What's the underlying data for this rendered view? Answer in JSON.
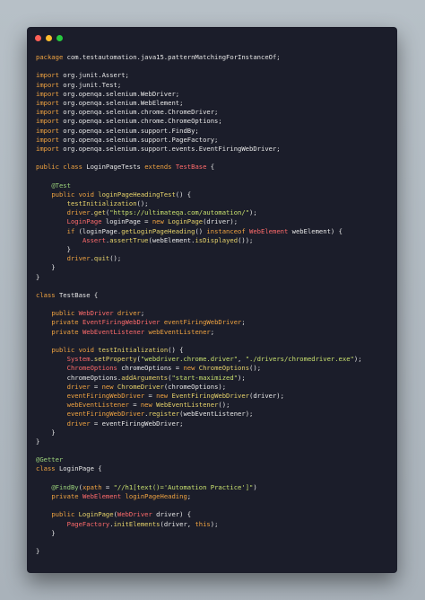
{
  "window": {
    "buttons": [
      {
        "name": "close",
        "color": "#ff5f56"
      },
      {
        "name": "minimize",
        "color": "#ffbd2e"
      },
      {
        "name": "zoom",
        "color": "#27c93f"
      }
    ]
  },
  "code": {
    "lines": [
      [
        [
          "kw",
          "package "
        ],
        [
          "pl",
          "com.testautomation.java15.patternMatchingForInstanceOf;"
        ]
      ],
      [],
      [
        [
          "kw",
          "import "
        ],
        [
          "pl",
          "org.junit.Assert;"
        ]
      ],
      [
        [
          "kw",
          "import "
        ],
        [
          "pl",
          "org.junit.Test;"
        ]
      ],
      [
        [
          "kw",
          "import "
        ],
        [
          "pl",
          "org.openqa.selenium.WebDriver;"
        ]
      ],
      [
        [
          "kw",
          "import "
        ],
        [
          "pl",
          "org.openqa.selenium.WebElement;"
        ]
      ],
      [
        [
          "kw",
          "import "
        ],
        [
          "pl",
          "org.openqa.selenium.chrome.ChromeDriver;"
        ]
      ],
      [
        [
          "kw",
          "import "
        ],
        [
          "pl",
          "org.openqa.selenium.chrome.ChromeOptions;"
        ]
      ],
      [
        [
          "kw",
          "import "
        ],
        [
          "pl",
          "org.openqa.selenium.support.FindBy;"
        ]
      ],
      [
        [
          "kw",
          "import "
        ],
        [
          "pl",
          "org.openqa.selenium.support.PageFactory;"
        ]
      ],
      [
        [
          "kw",
          "import "
        ],
        [
          "pl",
          "org.openqa.selenium.support.events.EventFiringWebDriver;"
        ]
      ],
      [],
      [
        [
          "kw",
          "public class "
        ],
        [
          "pl",
          "LoginPageTests "
        ],
        [
          "kw",
          "extends "
        ],
        [
          "tp",
          "TestBase"
        ],
        [
          "pl",
          " {"
        ]
      ],
      [],
      [
        [
          "pl",
          "    "
        ],
        [
          "an",
          "@Test"
        ]
      ],
      [
        [
          "pl",
          "    "
        ],
        [
          "kw",
          "public void "
        ],
        [
          "fn",
          "loginPageHeadingTest"
        ],
        [
          "pl",
          "() {"
        ]
      ],
      [
        [
          "pl",
          "        "
        ],
        [
          "fn",
          "testInitialization"
        ],
        [
          "pl",
          "();"
        ]
      ],
      [
        [
          "pl",
          "        "
        ],
        [
          "kw",
          "driver"
        ],
        [
          "pl",
          "."
        ],
        [
          "fn",
          "get"
        ],
        [
          "pl",
          "("
        ],
        [
          "str",
          "\"https://ultimateqa.com/automation/\""
        ],
        [
          "pl",
          ");"
        ]
      ],
      [
        [
          "pl",
          "        "
        ],
        [
          "tp",
          "LoginPage "
        ],
        [
          "pl",
          "loginPage = "
        ],
        [
          "kw",
          "new "
        ],
        [
          "fn",
          "LoginPage"
        ],
        [
          "pl",
          "(driver);"
        ]
      ],
      [
        [
          "pl",
          "        "
        ],
        [
          "kw",
          "if "
        ],
        [
          "pl",
          "(loginPage."
        ],
        [
          "fn",
          "getLoginPageHeading"
        ],
        [
          "pl",
          "() "
        ],
        [
          "kw",
          "instanceof "
        ],
        [
          "tp",
          "WebElement "
        ],
        [
          "pl",
          "webElement) {"
        ]
      ],
      [
        [
          "pl",
          "            "
        ],
        [
          "tp",
          "Assert"
        ],
        [
          "pl",
          "."
        ],
        [
          "fn",
          "assertTrue"
        ],
        [
          "pl",
          "(webElement."
        ],
        [
          "fn",
          "isDisplayed"
        ],
        [
          "pl",
          "());"
        ]
      ],
      [
        [
          "pl",
          "        }"
        ]
      ],
      [
        [
          "pl",
          "        "
        ],
        [
          "kw",
          "driver"
        ],
        [
          "pl",
          "."
        ],
        [
          "fn",
          "quit"
        ],
        [
          "pl",
          "();"
        ]
      ],
      [
        [
          "pl",
          "    }"
        ]
      ],
      [
        [
          "pl",
          "}"
        ]
      ],
      [],
      [
        [
          "kw",
          "class "
        ],
        [
          "pl",
          "TestBase {"
        ]
      ],
      [],
      [
        [
          "pl",
          "    "
        ],
        [
          "kw",
          "public "
        ],
        [
          "tp",
          "WebDriver "
        ],
        [
          "kw",
          "driver"
        ],
        [
          "pl",
          ";"
        ]
      ],
      [
        [
          "pl",
          "    "
        ],
        [
          "kw",
          "private "
        ],
        [
          "tp",
          "EventFiringWebDriver "
        ],
        [
          "kw",
          "eventFiringWebDriver"
        ],
        [
          "pl",
          ";"
        ]
      ],
      [
        [
          "pl",
          "    "
        ],
        [
          "kw",
          "private "
        ],
        [
          "tp",
          "WebEventListener "
        ],
        [
          "kw",
          "webEventListener"
        ],
        [
          "pl",
          ";"
        ]
      ],
      [],
      [
        [
          "pl",
          "    "
        ],
        [
          "kw",
          "public void "
        ],
        [
          "fn",
          "testInitialization"
        ],
        [
          "pl",
          "() {"
        ]
      ],
      [
        [
          "pl",
          "        "
        ],
        [
          "tp",
          "System"
        ],
        [
          "pl",
          "."
        ],
        [
          "fn",
          "setProperty"
        ],
        [
          "pl",
          "("
        ],
        [
          "str",
          "\"webdriver.chrome.driver\""
        ],
        [
          "pl",
          ", "
        ],
        [
          "str",
          "\"./drivers/chromedriver.exe\""
        ],
        [
          "pl",
          ");"
        ]
      ],
      [
        [
          "pl",
          "        "
        ],
        [
          "tp",
          "ChromeOptions "
        ],
        [
          "pl",
          "chromeOptions = "
        ],
        [
          "kw",
          "new "
        ],
        [
          "fn",
          "ChromeOptions"
        ],
        [
          "pl",
          "();"
        ]
      ],
      [
        [
          "pl",
          "        chromeOptions."
        ],
        [
          "fn",
          "addArguments"
        ],
        [
          "pl",
          "("
        ],
        [
          "str",
          "\"start-maximized\""
        ],
        [
          "pl",
          ");"
        ]
      ],
      [
        [
          "pl",
          "        "
        ],
        [
          "kw",
          "driver "
        ],
        [
          "pl",
          "= "
        ],
        [
          "kw",
          "new "
        ],
        [
          "fn",
          "ChromeDriver"
        ],
        [
          "pl",
          "(chromeOptions);"
        ]
      ],
      [
        [
          "pl",
          "        "
        ],
        [
          "kw",
          "eventFiringWebDriver "
        ],
        [
          "pl",
          "= "
        ],
        [
          "kw",
          "new "
        ],
        [
          "fn",
          "EventFiringWebDriver"
        ],
        [
          "pl",
          "(driver);"
        ]
      ],
      [
        [
          "pl",
          "        "
        ],
        [
          "kw",
          "webEventListener "
        ],
        [
          "pl",
          "= "
        ],
        [
          "kw",
          "new "
        ],
        [
          "fn",
          "WebEventListener"
        ],
        [
          "pl",
          "();"
        ]
      ],
      [
        [
          "pl",
          "        "
        ],
        [
          "kw",
          "eventFiringWebDriver"
        ],
        [
          "pl",
          "."
        ],
        [
          "fn",
          "register"
        ],
        [
          "pl",
          "(webEventListener);"
        ]
      ],
      [
        [
          "pl",
          "        "
        ],
        [
          "kw",
          "driver "
        ],
        [
          "pl",
          "= eventFiringWebDriver;"
        ]
      ],
      [
        [
          "pl",
          "    }"
        ]
      ],
      [
        [
          "pl",
          "}"
        ]
      ],
      [],
      [
        [
          "an",
          "@Getter"
        ]
      ],
      [
        [
          "kw",
          "class "
        ],
        [
          "pl",
          "LoginPage {"
        ]
      ],
      [],
      [
        [
          "pl",
          "    "
        ],
        [
          "an",
          "@FindBy"
        ],
        [
          "pl",
          "("
        ],
        [
          "kw",
          "xpath "
        ],
        [
          "pl",
          "= "
        ],
        [
          "str",
          "\"//h1[text()='Automation Practice']\""
        ],
        [
          "pl",
          ")"
        ]
      ],
      [
        [
          "pl",
          "    "
        ],
        [
          "kw",
          "private "
        ],
        [
          "tp",
          "WebElement "
        ],
        [
          "kw",
          "loginPageHeading"
        ],
        [
          "pl",
          ";"
        ]
      ],
      [],
      [
        [
          "pl",
          "    "
        ],
        [
          "kw",
          "public "
        ],
        [
          "fn",
          "LoginPage"
        ],
        [
          "pl",
          "("
        ],
        [
          "tp",
          "WebDriver "
        ],
        [
          "pl",
          "driver) {"
        ]
      ],
      [
        [
          "pl",
          "        "
        ],
        [
          "tp",
          "PageFactory"
        ],
        [
          "pl",
          "."
        ],
        [
          "fn",
          "initElements"
        ],
        [
          "pl",
          "(driver, "
        ],
        [
          "kw",
          "this"
        ],
        [
          "pl",
          ");"
        ]
      ],
      [
        [
          "pl",
          "    }"
        ]
      ],
      [],
      [
        [
          "pl",
          "}"
        ]
      ]
    ]
  }
}
